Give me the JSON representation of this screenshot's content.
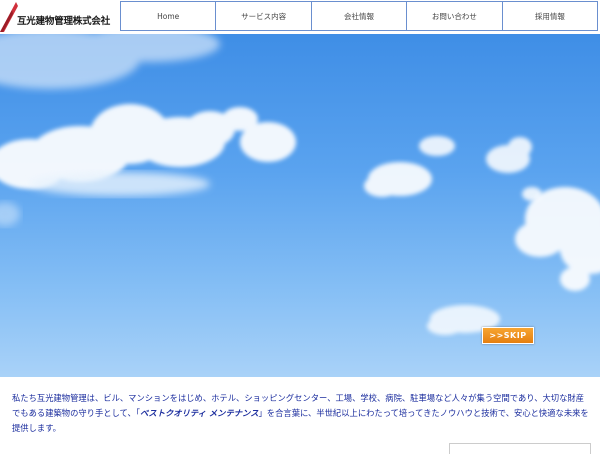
{
  "brand": {
    "company_name": "互光建物管理株式会社",
    "logo_color": "#d0303b"
  },
  "nav": {
    "items": [
      {
        "label": "Home"
      },
      {
        "label": "サービス内容"
      },
      {
        "label": "会社情報"
      },
      {
        "label": "お問い合わせ"
      },
      {
        "label": "採用情報"
      }
    ],
    "border_color": "#6a8fcf"
  },
  "hero": {
    "skip_label": ">>SKIP",
    "skip_color": "#e57f10"
  },
  "intro": {
    "text_before": "私たち互光建物管理は、ビル、マンションをはじめ、ホテル、ショッピングセンター、工場、学校、病院、駐車場など人々が集う空間であり、大切な財産でもある建築物の守り手として、「",
    "emphasis": "ベストクオリティ メンテナンス",
    "text_after": "」を合言葉に、半世紀以上にわたって培ってきたノウハウと技術で、安心と快適な未来を提供します。",
    "text_color": "#1b2d9e"
  }
}
